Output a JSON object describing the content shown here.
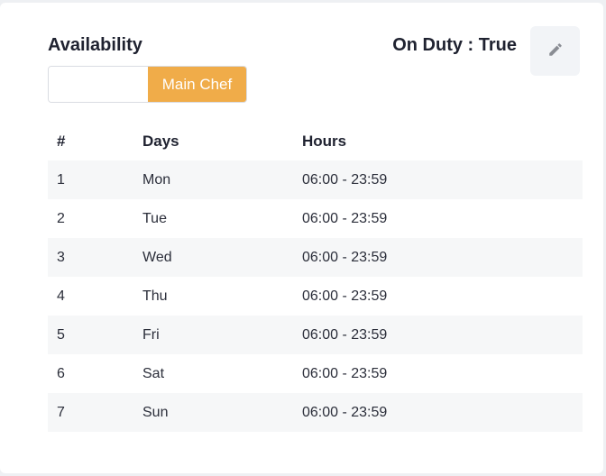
{
  "availability": {
    "title": "Availability",
    "role_input_value": "",
    "role_input_placeholder": "",
    "role_button_label": "Main Chef",
    "duty_text": "On Duty : True",
    "accent_color": "#f0ac49",
    "edit_icon": "pencil-icon"
  },
  "table": {
    "headers": [
      "#",
      "Days",
      "Hours"
    ],
    "rows": [
      [
        "1",
        "Mon",
        "06:00 - 23:59"
      ],
      [
        "2",
        "Tue",
        "06:00 - 23:59"
      ],
      [
        "3",
        "Wed",
        "06:00 - 23:59"
      ],
      [
        "4",
        "Thu",
        "06:00 - 23:59"
      ],
      [
        "5",
        "Fri",
        "06:00 - 23:59"
      ],
      [
        "6",
        "Sat",
        "06:00 - 23:59"
      ],
      [
        "7",
        "Sun",
        "06:00 - 23:59"
      ]
    ]
  }
}
